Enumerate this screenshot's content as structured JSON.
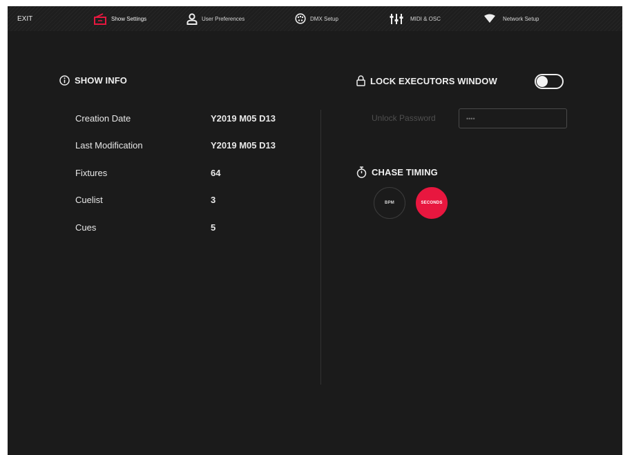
{
  "topbar": {
    "exit_label": "EXIT",
    "tabs": [
      {
        "label": "Show Settings",
        "icon": "show-settings-icon",
        "active": true
      },
      {
        "label": "User Preferences",
        "icon": "user-icon"
      },
      {
        "label": "DMX Setup",
        "icon": "dmx-connector-icon"
      },
      {
        "label": "MIDI & OSC",
        "icon": "faders-icon"
      },
      {
        "label": "Network Setup",
        "icon": "wifi-icon"
      }
    ]
  },
  "show_info": {
    "title": "SHOW INFO",
    "rows": [
      {
        "label": "Creation Date",
        "value": "Y2019 M05 D13"
      },
      {
        "label": "Last Modification",
        "value": "Y2019 M05 D13"
      },
      {
        "label": "Fixtures",
        "value": "64"
      },
      {
        "label": "Cuelist",
        "value": "3"
      },
      {
        "label": "Cues",
        "value": "5"
      }
    ]
  },
  "lock": {
    "title": "LOCK EXECUTORS WINDOW",
    "toggle_on": false,
    "password_label": "Unlock Password",
    "password_value": "••••"
  },
  "chase": {
    "title": "CHASE TIMING",
    "bpm_label": "BPM",
    "seconds_label": "SECONDS",
    "selected": "SECONDS"
  },
  "colors": {
    "accent": "#e8173f",
    "background": "#1b1b1b",
    "text": "#e9e9e9"
  }
}
